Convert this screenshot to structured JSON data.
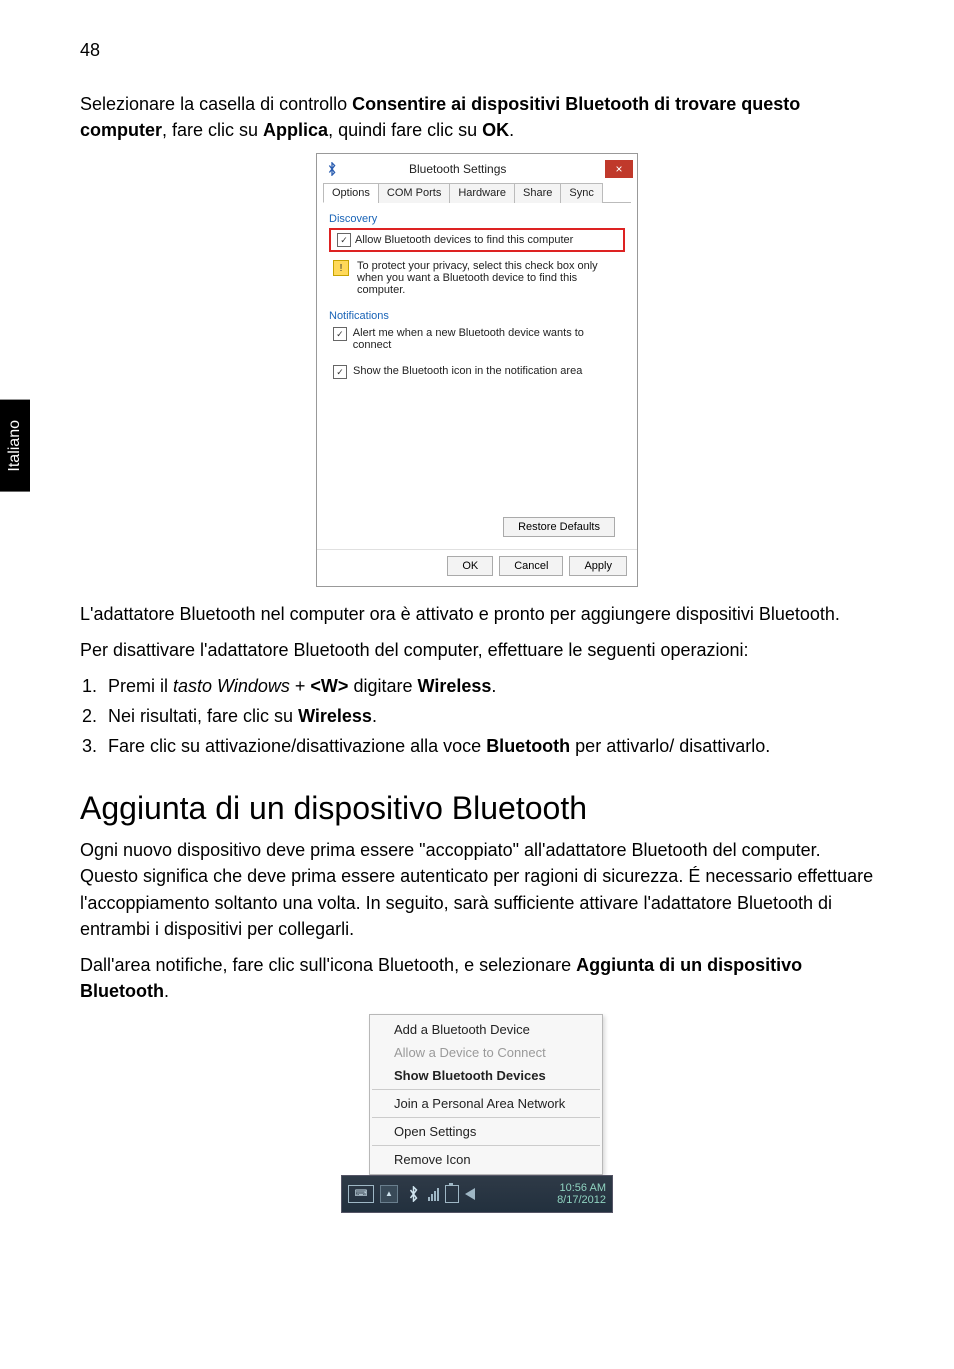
{
  "page_number": "48",
  "side_tab": "Italiano",
  "intro_part1": "Selezionare la casella di controllo ",
  "intro_bold1": "Consentire ai dispositivi Bluetooth di trovare questo computer",
  "intro_part2": ", fare clic su ",
  "intro_bold2": "Applica",
  "intro_part3": ", quindi fare clic su ",
  "intro_bold3": "OK",
  "intro_part4": ".",
  "bt_dialog": {
    "title": "Bluetooth Settings",
    "tabs": [
      "Options",
      "COM Ports",
      "Hardware",
      "Share",
      "Sync"
    ],
    "discovery_label": "Discovery",
    "allow_find": "Allow Bluetooth devices to find this computer",
    "privacy_warning": "To protect your privacy, select this check box only when you want a Bluetooth device to find this computer.",
    "notifications_label": "Notifications",
    "alert_connect": "Alert me when a new Bluetooth device wants to connect",
    "show_icon": "Show the Bluetooth icon in the notification area",
    "restore_defaults": "Restore Defaults",
    "ok": "OK",
    "cancel": "Cancel",
    "apply": "Apply"
  },
  "after_dialog_1": "L'adattatore Bluetooth nel computer ora è attivato e pronto per aggiungere dispositivi Bluetooth.",
  "after_dialog_2": "Per disattivare l'adattatore Bluetooth del computer, effettuare le seguenti operazioni:",
  "steps": {
    "s1_a": "Premi il ",
    "s1_em": "tasto Windows",
    "s1_b": " + ",
    "s1_bold1": "<W>",
    "s1_c": " digitare ",
    "s1_bold2": "Wireless",
    "s1_d": ".",
    "s2_a": "Nei risultati, fare clic su ",
    "s2_bold": "Wireless",
    "s2_b": ".",
    "s3_a": "Fare clic su attivazione/disattivazione alla voce ",
    "s3_bold": "Bluetooth",
    "s3_b": " per attivarlo/ disattivarlo."
  },
  "heading": "Aggiunta di un dispositivo Bluetooth",
  "para2": "Ogni nuovo dispositivo deve prima essere \"accoppiato\" all'adattatore Bluetooth del computer. Questo significa che deve prima essere autenticato per ragioni di sicurezza. É necessario effettuare l'accoppiamento soltanto una volta. In seguito, sarà sufficiente attivare l'adattatore Bluetooth di entrambi i dispositivi per collegarli.",
  "para3_a": "Dall'area notifiche, fare clic sull'icona Bluetooth, e selezionare ",
  "para3_bold": "Aggiunta di un dispositivo Bluetooth",
  "para3_b": ".",
  "tray_menu": {
    "add": "Add a Bluetooth Device",
    "allow": "Allow a Device to Connect",
    "show": "Show Bluetooth Devices",
    "join": "Join a Personal Area Network",
    "open": "Open Settings",
    "remove": "Remove Icon"
  },
  "taskbar": {
    "time": "10:56 AM",
    "date": "8/17/2012"
  }
}
